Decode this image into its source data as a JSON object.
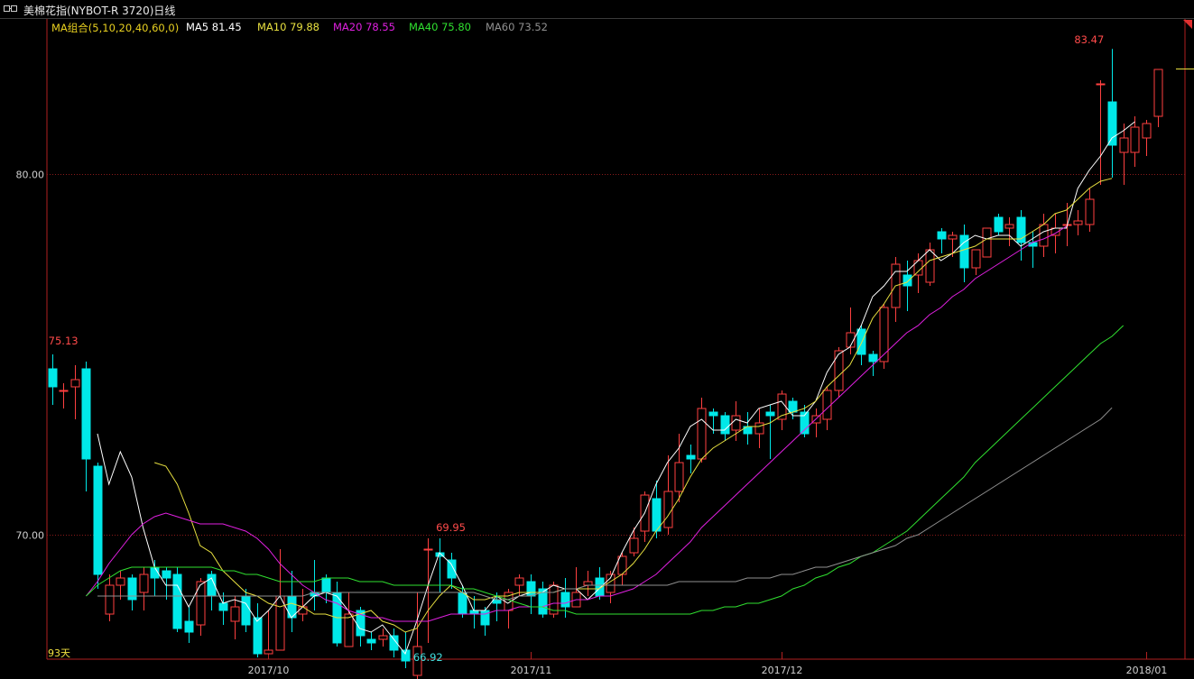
{
  "window": {
    "title": "美棉花指(NYBOT-R 3720)日线"
  },
  "legend": {
    "group": {
      "label": "MA组合(5,10,20,40,60,0)",
      "color": "#e8d020"
    },
    "items": [
      {
        "label": "MA5 81.45",
        "color": "#ffffff"
      },
      {
        "label": "MA10 79.88",
        "color": "#e8e040"
      },
      {
        "label": "MA20 78.55",
        "color": "#e020e0"
      },
      {
        "label": "MA40 75.80",
        "color": "#30e030"
      },
      {
        "label": "MA60 73.52",
        "color": "#909090"
      }
    ]
  },
  "days_label": "93天",
  "colors": {
    "up": "#ff4040",
    "down": "#00e8e8",
    "axis": "#b02020",
    "grid": "#8a1a1a",
    "tick_text": "#d0d0d0",
    "hl_text": "#ff4a4a",
    "low_text": "#40e0e0"
  },
  "chart_data": {
    "type": "candlestick",
    "title": "美棉花指(NYBOT-R 3720)日线",
    "y_ticks": [
      "80.00",
      "70.00"
    ],
    "y_tick_values": [
      80,
      70
    ],
    "ylim": [
      66.55,
      84.3
    ],
    "x_ticks": [
      {
        "label": "2017/10",
        "index": 19
      },
      {
        "label": "2017/11",
        "index": 42
      },
      {
        "label": "2017/12",
        "index": 64
      },
      {
        "label": "2018/01",
        "index": 96
      }
    ],
    "annotations": [
      {
        "text": "83.47",
        "index": 91,
        "value": 83.47,
        "pos": "above"
      },
      {
        "text": "75.13",
        "index": 1,
        "value": 75.13,
        "pos": "above"
      },
      {
        "text": "69.95",
        "index": 35,
        "value": 69.95,
        "pos": "above"
      },
      {
        "text": "66.92",
        "index": 33,
        "value": 66.92,
        "pos": "below"
      }
    ],
    "candles": [
      [
        74.6,
        74.1,
        75.0,
        73.6
      ],
      [
        74.0,
        74.0,
        74.2,
        73.5
      ],
      [
        74.1,
        74.3,
        74.7,
        73.2
      ],
      [
        74.6,
        72.1,
        74.8,
        71.2
      ],
      [
        71.9,
        68.9,
        72.0,
        68.5
      ],
      [
        67.8,
        68.6,
        68.9,
        67.6
      ],
      [
        68.6,
        68.8,
        69.0,
        68.2
      ],
      [
        68.8,
        68.2,
        68.9,
        67.9
      ],
      [
        68.4,
        68.9,
        69.1,
        67.9
      ],
      [
        69.1,
        68.8,
        69.3,
        68.3
      ],
      [
        69.0,
        68.8,
        69.1,
        68.2
      ],
      [
        68.9,
        67.4,
        69.1,
        67.3
      ],
      [
        67.6,
        67.3,
        68.0,
        67.0
      ],
      [
        67.5,
        68.7,
        68.8,
        67.2
      ],
      [
        68.9,
        68.3,
        69.0,
        67.9
      ],
      [
        68.1,
        67.9,
        68.4,
        67.5
      ],
      [
        67.6,
        68.0,
        68.3,
        67.1
      ],
      [
        68.3,
        67.5,
        68.5,
        67.3
      ],
      [
        67.7,
        66.7,
        68.1,
        66.6
      ],
      [
        66.7,
        66.8,
        67.9,
        66.7
      ],
      [
        66.8,
        68.3,
        69.6,
        66.8
      ],
      [
        68.3,
        67.7,
        69.0,
        67.3
      ],
      [
        67.8,
        68.0,
        68.5,
        67.6
      ],
      [
        68.4,
        68.3,
        69.3,
        67.9
      ],
      [
        68.8,
        68.4,
        68.9,
        68.1
      ],
      [
        68.4,
        67.0,
        68.7,
        66.9
      ],
      [
        66.9,
        67.8,
        68.4,
        66.9
      ],
      [
        67.9,
        67.2,
        68.0,
        66.9
      ],
      [
        67.1,
        67.0,
        67.3,
        66.8
      ],
      [
        67.1,
        67.2,
        67.4,
        66.9
      ],
      [
        67.2,
        66.8,
        67.4,
        66.6
      ],
      [
        66.8,
        66.5,
        67.3,
        66.3
      ],
      [
        66.1,
        66.9,
        68.4,
        65.9
      ],
      [
        69.6,
        69.6,
        69.9,
        67.0
      ],
      [
        69.5,
        69.4,
        69.9,
        68.4
      ],
      [
        69.3,
        68.8,
        69.5,
        68.5
      ],
      [
        68.4,
        67.8,
        68.6,
        67.7
      ],
      [
        67.9,
        67.8,
        68.3,
        67.4
      ],
      [
        67.9,
        67.5,
        68.0,
        67.2
      ],
      [
        68.2,
        68.1,
        68.4,
        67.6
      ],
      [
        67.9,
        68.4,
        68.5,
        67.4
      ],
      [
        68.6,
        68.8,
        68.9,
        68.3
      ],
      [
        68.7,
        68.3,
        68.9,
        67.8
      ],
      [
        68.5,
        67.8,
        68.7,
        67.7
      ],
      [
        67.8,
        68.6,
        68.7,
        67.7
      ],
      [
        68.4,
        68.0,
        68.8,
        67.7
      ],
      [
        68.0,
        68.4,
        69.1,
        68.0
      ],
      [
        68.6,
        68.7,
        69.0,
        68.3
      ],
      [
        68.8,
        68.3,
        69.1,
        68.2
      ],
      [
        68.4,
        68.9,
        69.0,
        68.1
      ],
      [
        68.9,
        69.4,
        69.5,
        68.6
      ],
      [
        69.5,
        69.9,
        70.2,
        69.4
      ],
      [
        70.1,
        71.1,
        71.2,
        69.8
      ],
      [
        71.0,
        70.1,
        71.5,
        69.9
      ],
      [
        70.2,
        71.2,
        72.2,
        70.0
      ],
      [
        71.2,
        72.0,
        72.8,
        70.9
      ],
      [
        72.2,
        72.1,
        72.5,
        71.7
      ],
      [
        72.1,
        73.5,
        73.8,
        72.0
      ],
      [
        73.4,
        73.3,
        73.5,
        72.8
      ],
      [
        73.3,
        72.8,
        73.4,
        72.6
      ],
      [
        72.9,
        73.3,
        73.7,
        72.6
      ],
      [
        73.0,
        72.8,
        73.4,
        72.5
      ],
      [
        72.8,
        73.1,
        73.5,
        72.4
      ],
      [
        73.4,
        73.3,
        73.6,
        72.1
      ],
      [
        73.2,
        73.9,
        74.0,
        72.9
      ],
      [
        73.7,
        73.4,
        73.8,
        73.2
      ],
      [
        73.4,
        72.8,
        73.6,
        72.7
      ],
      [
        73.1,
        73.3,
        73.5,
        72.7
      ],
      [
        73.2,
        74.0,
        74.1,
        72.9
      ],
      [
        74.0,
        75.1,
        75.2,
        73.8
      ],
      [
        75.2,
        75.6,
        76.3,
        75.0
      ],
      [
        75.7,
        75.0,
        75.8,
        74.7
      ],
      [
        75.0,
        74.8,
        75.1,
        74.4
      ],
      [
        74.8,
        76.3,
        76.4,
        74.6
      ],
      [
        76.3,
        77.5,
        77.7,
        75.9
      ],
      [
        77.2,
        76.9,
        77.6,
        76.2
      ],
      [
        77.2,
        77.6,
        77.8,
        76.7
      ],
      [
        77.0,
        77.9,
        78.1,
        76.9
      ],
      [
        78.4,
        78.2,
        78.5,
        77.8
      ],
      [
        78.2,
        78.3,
        78.4,
        77.7
      ],
      [
        78.3,
        77.4,
        78.6,
        77.0
      ],
      [
        77.4,
        77.9,
        77.9,
        77.2
      ],
      [
        77.7,
        78.5,
        78.5,
        77.7
      ],
      [
        78.8,
        78.4,
        78.9,
        78.3
      ],
      [
        78.5,
        78.6,
        78.8,
        78.0
      ],
      [
        78.8,
        78.1,
        79.0,
        77.6
      ],
      [
        78.1,
        78.0,
        78.4,
        77.4
      ],
      [
        78.0,
        78.6,
        78.9,
        77.7
      ],
      [
        78.3,
        78.5,
        78.9,
        77.8
      ],
      [
        78.6,
        78.6,
        79.2,
        78.0
      ],
      [
        78.6,
        78.7,
        79.0,
        78.3
      ],
      [
        78.6,
        79.3,
        79.6,
        78.4
      ],
      [
        82.5,
        82.5,
        82.6,
        79.7
      ],
      [
        82.0,
        80.8,
        83.47,
        79.9
      ],
      [
        80.6,
        81.0,
        81.4,
        79.7
      ],
      [
        80.6,
        81.3,
        81.6,
        80.2
      ],
      [
        81.0,
        81.4,
        81.5,
        80.5
      ],
      [
        81.6,
        82.9,
        82.9,
        81.3
      ]
    ],
    "series": [
      {
        "name": "MA5",
        "color": "#ffffff",
        "values": [
          null,
          null,
          null,
          null,
          72.8,
          71.4,
          72.3,
          71.6,
          70.2,
          69.1,
          68.6,
          68.6,
          68.0,
          68.6,
          68.8,
          68.1,
          68.2,
          68.1,
          67.6,
          67.9,
          68.3,
          67.7,
          68.0,
          68.3,
          68.4,
          68.3,
          67.9,
          67.4,
          67.3,
          67.5,
          67.1,
          66.7,
          67.6,
          68.6,
          69.5,
          69.2,
          68.6,
          67.9,
          67.9,
          68.3,
          68.1,
          68.3,
          68.4,
          68.4,
          68.6,
          68.5,
          68.5,
          68.2,
          68.5,
          68.8,
          69.5,
          70.1,
          70.6,
          71.4,
          72.0,
          72.4,
          73.0,
          73.2,
          72.9,
          72.9,
          73.2,
          73.1,
          73.5,
          73.6,
          73.7,
          73.3,
          73.3,
          73.7,
          74.5,
          75.0,
          75.2,
          75.8,
          76.6,
          76.9,
          77.3,
          77.3,
          77.6,
          77.9,
          77.6,
          77.8,
          78.1,
          78.3,
          78.2,
          78.3,
          78.3,
          78.0,
          78.2,
          78.4,
          78.5,
          78.5,
          79.6,
          80.1,
          80.5,
          81.0,
          81.2,
          81.45
        ]
      },
      {
        "name": "MA10",
        "color": "#e8e040",
        "values": [
          null,
          null,
          null,
          null,
          null,
          null,
          null,
          null,
          null,
          72.0,
          71.9,
          71.4,
          70.6,
          69.7,
          69.5,
          69.0,
          68.7,
          68.4,
          68.3,
          68.1,
          68.0,
          68.1,
          68.0,
          67.8,
          67.8,
          67.7,
          67.7,
          67.8,
          67.9,
          67.6,
          67.5,
          67.3,
          67.4,
          67.9,
          68.3,
          68.6,
          68.4,
          68.2,
          68.2,
          68.3,
          68.3,
          68.4,
          68.4,
          68.4,
          68.4,
          68.5,
          68.5,
          68.5,
          68.5,
          68.7,
          68.9,
          69.2,
          69.6,
          70.1,
          70.5,
          71.0,
          71.6,
          72.1,
          72.4,
          72.6,
          72.8,
          73.0,
          73.0,
          73.1,
          73.3,
          73.4,
          73.5,
          73.7,
          74.1,
          74.4,
          74.7,
          75.3,
          76.0,
          76.4,
          76.9,
          77.0,
          77.3,
          77.6,
          77.7,
          77.8,
          77.9,
          78.0,
          78.2,
          78.2,
          78.2,
          78.2,
          78.4,
          78.6,
          78.9,
          79.0,
          79.3,
          79.6,
          79.8,
          79.88
        ]
      },
      {
        "name": "MA20",
        "color": "#e020e0",
        "values": [
          null,
          null,
          null,
          68.3,
          68.7,
          69.2,
          69.6,
          70.0,
          70.3,
          70.5,
          70.6,
          70.5,
          70.4,
          70.3,
          70.3,
          70.3,
          70.2,
          70.1,
          69.9,
          69.6,
          69.2,
          68.9,
          68.6,
          68.4,
          68.2,
          68.1,
          67.9,
          67.8,
          67.7,
          67.7,
          67.6,
          67.6,
          67.6,
          67.6,
          67.7,
          67.8,
          67.8,
          67.8,
          67.8,
          67.9,
          67.9,
          68.0,
          68.0,
          68.0,
          68.1,
          68.1,
          68.2,
          68.2,
          68.3,
          68.3,
          68.4,
          68.5,
          68.7,
          68.9,
          69.2,
          69.5,
          69.8,
          70.2,
          70.5,
          70.8,
          71.1,
          71.4,
          71.7,
          72.0,
          72.3,
          72.6,
          72.9,
          73.2,
          73.5,
          73.8,
          74.1,
          74.4,
          74.7,
          75.0,
          75.3,
          75.6,
          75.8,
          76.1,
          76.3,
          76.6,
          76.8,
          77.1,
          77.3,
          77.5,
          77.7,
          77.9,
          78.1,
          78.2,
          78.35,
          78.55
        ]
      },
      {
        "name": "MA40",
        "color": "#30e030",
        "values": [
          null,
          null,
          null,
          68.3,
          68.6,
          68.8,
          69.0,
          69.1,
          69.1,
          69.1,
          69.1,
          69.1,
          69.1,
          69.1,
          69.1,
          69.0,
          69.0,
          68.9,
          68.9,
          68.8,
          68.7,
          68.7,
          68.7,
          68.7,
          68.8,
          68.8,
          68.8,
          68.7,
          68.7,
          68.7,
          68.6,
          68.6,
          68.6,
          68.6,
          68.6,
          68.6,
          68.5,
          68.5,
          68.4,
          68.3,
          68.2,
          68.1,
          68.0,
          68.0,
          67.9,
          67.9,
          67.8,
          67.8,
          67.8,
          67.8,
          67.8,
          67.8,
          67.8,
          67.8,
          67.8,
          67.8,
          67.8,
          67.9,
          67.9,
          68.0,
          68.0,
          68.1,
          68.1,
          68.2,
          68.3,
          68.5,
          68.6,
          68.8,
          68.9,
          69.1,
          69.2,
          69.4,
          69.5,
          69.7,
          69.9,
          70.1,
          70.4,
          70.7,
          71.0,
          71.3,
          71.6,
          72.0,
          72.3,
          72.6,
          72.9,
          73.2,
          73.5,
          73.8,
          74.1,
          74.4,
          74.7,
          75.0,
          75.3,
          75.5,
          75.8
        ]
      },
      {
        "name": "MA60",
        "color": "#909090",
        "values": [
          null,
          null,
          null,
          null,
          68.3,
          68.3,
          68.3,
          68.3,
          68.3,
          68.3,
          68.3,
          68.3,
          68.3,
          68.3,
          68.3,
          68.3,
          68.3,
          68.3,
          68.3,
          68.3,
          68.3,
          68.3,
          68.3,
          68.4,
          68.4,
          68.4,
          68.4,
          68.4,
          68.4,
          68.4,
          68.4,
          68.4,
          68.4,
          68.4,
          68.4,
          68.4,
          68.4,
          68.4,
          68.3,
          68.2,
          68.2,
          68.3,
          68.3,
          68.4,
          68.4,
          68.5,
          68.5,
          68.6,
          68.6,
          68.6,
          68.6,
          68.6,
          68.6,
          68.6,
          68.6,
          68.7,
          68.7,
          68.7,
          68.7,
          68.7,
          68.7,
          68.8,
          68.8,
          68.8,
          68.9,
          68.9,
          69.0,
          69.1,
          69.1,
          69.2,
          69.3,
          69.4,
          69.5,
          69.6,
          69.7,
          69.9,
          70.0,
          70.2,
          70.4,
          70.6,
          70.8,
          71.0,
          71.2,
          71.4,
          71.6,
          71.8,
          72.0,
          72.2,
          72.4,
          72.6,
          72.8,
          73.0,
          73.2,
          73.52
        ]
      }
    ]
  }
}
